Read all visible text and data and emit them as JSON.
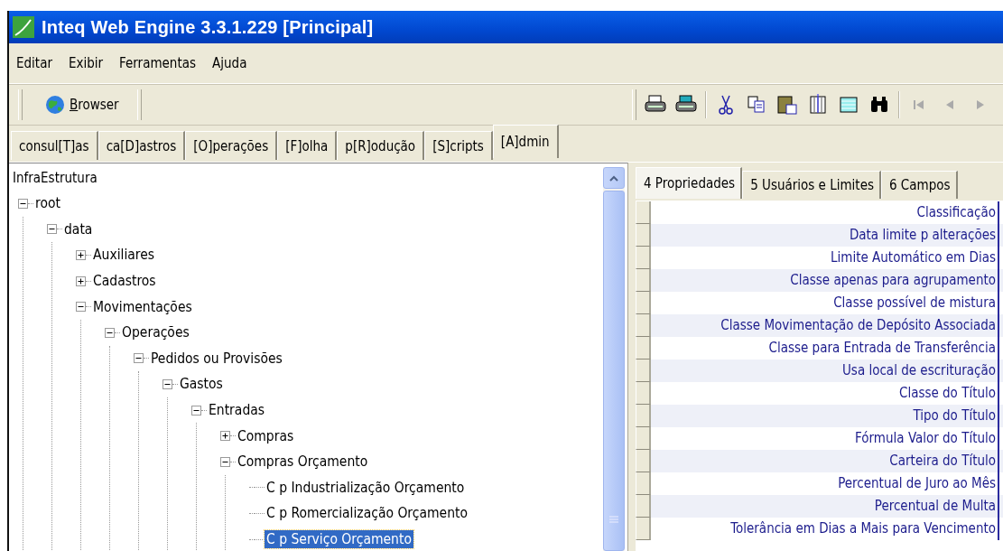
{
  "window": {
    "title": "Inteq Web Engine 3.3.1.229 [Principal]"
  },
  "menu": [
    "Editar",
    "Exibir",
    "Ferramentas",
    "Ajuda"
  ],
  "toolbar": {
    "browser_button": "Browser",
    "tools": [
      {
        "kind": "printer"
      },
      {
        "kind": "printer-color"
      },
      {
        "kind": "sep"
      },
      {
        "kind": "cut"
      },
      {
        "kind": "copy"
      },
      {
        "kind": "paste"
      },
      {
        "kind": "columns"
      },
      {
        "kind": "grid"
      },
      {
        "kind": "find"
      },
      {
        "kind": "sep"
      },
      {
        "kind": "first",
        "disabled": true
      },
      {
        "kind": "prev",
        "disabled": true
      },
      {
        "kind": "next",
        "disabled": true
      }
    ]
  },
  "tabs": [
    {
      "label": "consul[T]as",
      "selected": false
    },
    {
      "label": "ca[D]astros",
      "selected": false
    },
    {
      "label": "[O]perações",
      "selected": false
    },
    {
      "label": "[F]olha",
      "selected": false
    },
    {
      "label": "p[R]odução",
      "selected": false
    },
    {
      "label": "[S]cripts",
      "selected": false
    },
    {
      "label": "[A]dmin",
      "selected": true
    }
  ],
  "tree": {
    "title": "InfraEstrutura",
    "nodes": [
      {
        "label": "root",
        "kind": "branch",
        "expanded": true,
        "selected": false,
        "children": [
          {
            "label": "data",
            "kind": "branch",
            "expanded": true,
            "selected": false,
            "children": [
              {
                "label": "Auxiliares",
                "kind": "branch",
                "expanded": false,
                "selected": false
              },
              {
                "label": "Cadastros",
                "kind": "branch",
                "expanded": false,
                "selected": false
              },
              {
                "label": "Movimentações",
                "kind": "branch",
                "expanded": true,
                "selected": false,
                "children": [
                  {
                    "label": "Operações",
                    "kind": "branch",
                    "expanded": true,
                    "selected": false,
                    "children": [
                      {
                        "label": "Pedidos ou Provisões",
                        "kind": "branch",
                        "expanded": true,
                        "selected": false,
                        "children": [
                          {
                            "label": "Gastos",
                            "kind": "branch",
                            "expanded": true,
                            "selected": false,
                            "children": [
                              {
                                "label": "Entradas",
                                "kind": "branch",
                                "expanded": true,
                                "selected": false,
                                "children": [
                                  {
                                    "label": "Compras",
                                    "kind": "branch",
                                    "expanded": false,
                                    "selected": false
                                  },
                                  {
                                    "label": "Compras Orçamento",
                                    "kind": "branch",
                                    "expanded": true,
                                    "selected": false,
                                    "children": [
                                      {
                                        "label": "C p Industrialização Orçamento",
                                        "kind": "leaf",
                                        "selected": false
                                      },
                                      {
                                        "label": "C p Romercialização Orçamento",
                                        "kind": "leaf",
                                        "selected": false
                                      },
                                      {
                                        "label": "C p Serviço Orçamento",
                                        "kind": "leaf",
                                        "selected": true
                                      }
                                    ]
                                  }
                                ]
                              }
                            ]
                          }
                        ]
                      }
                    ]
                  }
                ]
              }
            ]
          }
        ]
      }
    ]
  },
  "detail_tabs": [
    {
      "label": "4 Propriedades",
      "selected": true
    },
    {
      "label": "5 Usuários e Limites",
      "selected": false
    },
    {
      "label": "6 Campos",
      "selected": false
    }
  ],
  "properties": [
    "Classificação",
    "Data limite p alterações",
    "Limite Automático em Dias",
    "Classe apenas para agrupamento",
    "Classe possível de mistura",
    "Classe Movimentação de Depósito Associada",
    "Classe para Entrada de Transferência",
    "Usa local de escrituração",
    "Classe do Título",
    "Tipo do Título",
    "Fórmula Valor do Título",
    "Carteira do Título",
    "Percentual de Juro ao Mês",
    "Percentual de Multa",
    "Tolerância em Dias a Mais para Vencimento"
  ]
}
